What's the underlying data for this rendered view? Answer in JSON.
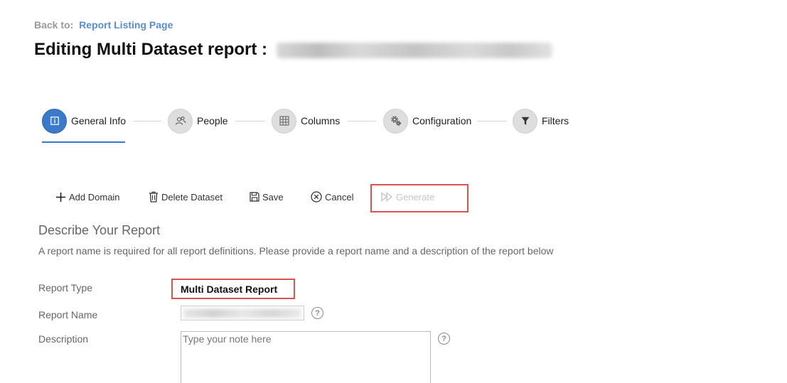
{
  "header": {
    "back_label": "Back to:",
    "back_link": "Report Listing Page",
    "title_prefix": "Editing Multi Dataset report :"
  },
  "stepper": {
    "steps": [
      {
        "label": "General Info",
        "icon": "info-icon",
        "active": true
      },
      {
        "label": "People",
        "icon": "people-icon",
        "active": false
      },
      {
        "label": "Columns",
        "icon": "grid-icon",
        "active": false
      },
      {
        "label": "Configuration",
        "icon": "gears-icon",
        "active": false
      },
      {
        "label": "Filters",
        "icon": "filter-icon",
        "active": false
      }
    ]
  },
  "toolbar": {
    "add_domain": "Add Domain",
    "delete_dataset": "Delete Dataset",
    "save": "Save",
    "cancel": "Cancel",
    "generate": "Generate"
  },
  "section": {
    "title": "Describe Your Report",
    "description": "A report name is required for all report definitions. Please provide a report name and a description of the report below"
  },
  "form": {
    "report_type_label": "Report Type",
    "report_type_value": "Multi Dataset Report",
    "report_name_label": "Report Name",
    "description_label": "Description",
    "description_placeholder": "Type your note here",
    "help_glyph": "?"
  },
  "colors": {
    "accent": "#3a7ac8",
    "highlight_border": "#d9534f",
    "link": "#5b8ec9"
  }
}
